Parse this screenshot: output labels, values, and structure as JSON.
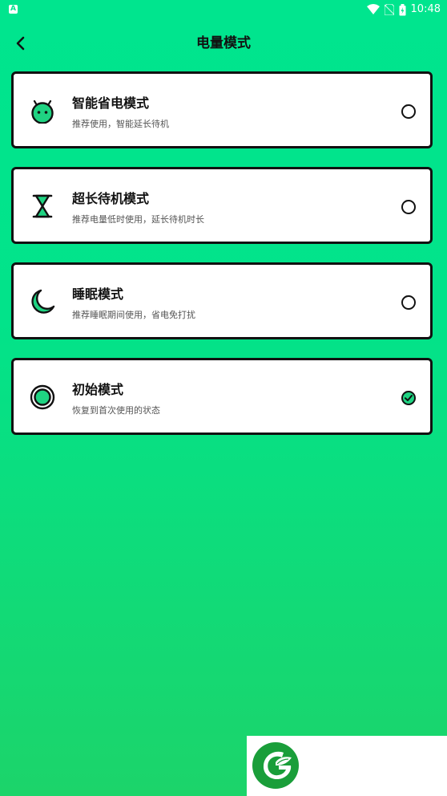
{
  "status_bar": {
    "time": "10:48",
    "left_icon_letter": "A"
  },
  "header": {
    "title": "电量模式"
  },
  "modes": [
    {
      "title": "智能省电模式",
      "subtitle": "推荐使用，智能延长待机",
      "icon": "robot-face-icon",
      "selected": false
    },
    {
      "title": "超长待机模式",
      "subtitle": "推荐电量低时使用，延长待机时长",
      "icon": "hourglass-icon",
      "selected": false
    },
    {
      "title": "睡眠模式",
      "subtitle": "推荐睡眠期间使用，省电免打扰",
      "icon": "moon-icon",
      "selected": false
    },
    {
      "title": "初始模式",
      "subtitle": "恢复到首次使用的状态",
      "icon": "target-ring-icon",
      "selected": true
    }
  ],
  "colors": {
    "accent": "#1fd382",
    "background_top": "#00e58e",
    "background_bottom": "#1cd46a",
    "logo_green": "#1a9e3a"
  }
}
